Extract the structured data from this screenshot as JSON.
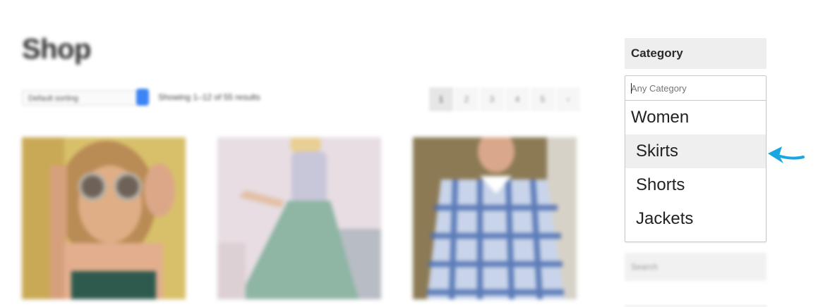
{
  "shop": {
    "title": "Shop",
    "sort": {
      "selected": "Default sorting"
    },
    "result_count": "Showing 1–12 of 55 results",
    "pagination": [
      "1",
      "2",
      "3",
      "4",
      "5",
      "›"
    ],
    "current_page": "1"
  },
  "sidebar": {
    "category_widget": {
      "title": "Category",
      "search_placeholder": "Any Category",
      "options": [
        {
          "label": "Women",
          "level": "group"
        },
        {
          "label": "Skirts",
          "level": "child",
          "highlighted": true
        },
        {
          "label": "Shorts",
          "level": "child"
        },
        {
          "label": "Jackets",
          "level": "child"
        }
      ]
    },
    "search": {
      "placeholder": "Search"
    }
  },
  "colors": {
    "accent_blue": "#3d84f5",
    "arrow_cyan": "#1aa7e0",
    "highlight": "#efefef",
    "widget_bg": "#eeeeee"
  },
  "icons": {
    "annotation": "arrow-left-icon",
    "next_page": "chevron-right-icon"
  }
}
